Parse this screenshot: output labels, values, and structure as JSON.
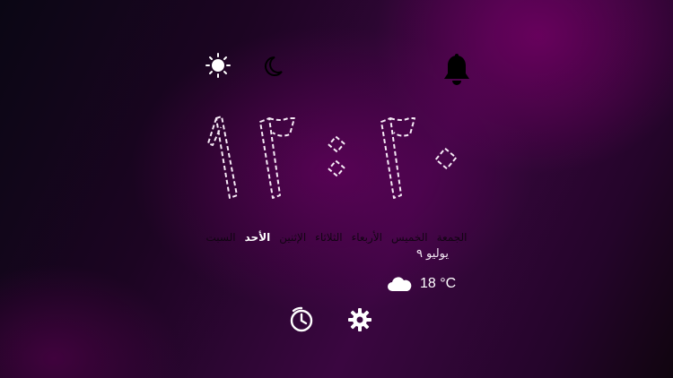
{
  "top_bar": {
    "day_mode_icon": "sun-icon",
    "night_mode_icon": "moon-icon",
    "notification_icon": "bell-icon"
  },
  "clock": {
    "time": "١٢:٢٠",
    "hours": "١٢",
    "minutes": "٢٠"
  },
  "weekdays": {
    "items": [
      "السبت",
      "الأحد",
      "الإثنين",
      "الثلاثاء",
      "الأربعاء",
      "الخميس",
      "الجمعة"
    ],
    "active_index": 1
  },
  "date": "يوليو ٩",
  "weather": {
    "icon": "cloud-icon",
    "temperature": "18 °C"
  },
  "bottom_bar": {
    "alarm_icon": "alarm-clock-icon",
    "settings_icon": "gear-icon"
  },
  "colors": {
    "accent": "#5a0656",
    "text": "#ffffff",
    "muted_text": "#0a050c"
  }
}
